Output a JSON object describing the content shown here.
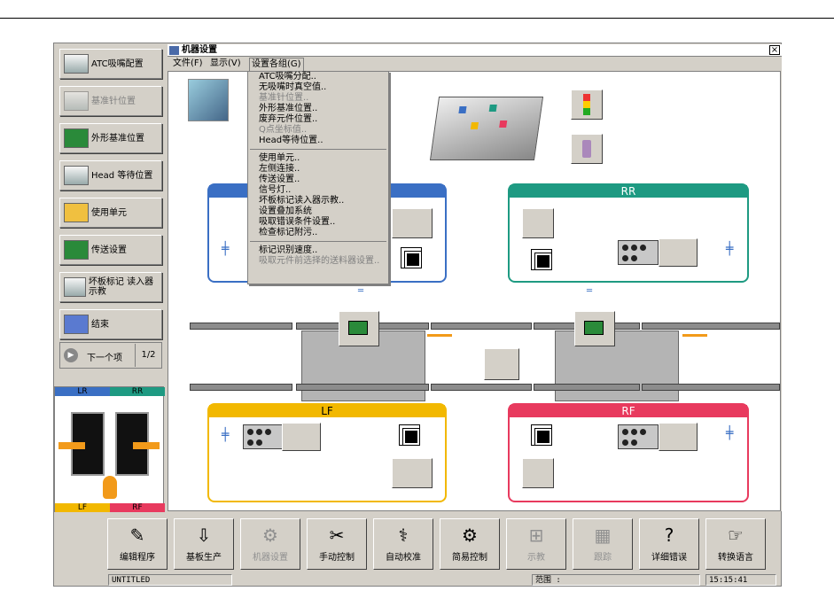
{
  "left_panel": {
    "buttons": [
      {
        "label": "ATC吸嘴配置"
      },
      {
        "label": "基准针位置"
      },
      {
        "label": "外形基准位置"
      },
      {
        "label": "Head 等待位置"
      },
      {
        "label": "使用单元"
      },
      {
        "label": "传送设置"
      },
      {
        "label": "坏板标记 读入器示教"
      },
      {
        "label": "结束"
      }
    ],
    "next_label": "下一个项",
    "page": "1/2",
    "heads": {
      "lr": "LR",
      "rr": "RR",
      "lf": "LF",
      "rf": "RF"
    }
  },
  "window": {
    "title": "机器设置",
    "close": "×",
    "menu": [
      "文件(F)",
      "显示(V)",
      "设置各组(G)"
    ],
    "dropdown": [
      {
        "label": "ATC吸嘴分配..",
        "disabled": false
      },
      {
        "label": "无吸嘴时真空值..",
        "disabled": false
      },
      {
        "label": "基准针位置..",
        "disabled": true
      },
      {
        "label": "外形基准位置..",
        "disabled": false
      },
      {
        "label": "废弃元件位置..",
        "disabled": false
      },
      {
        "label": "Q点坐标值..",
        "disabled": true
      },
      {
        "label": "Head等待位置..",
        "disabled": false
      },
      {
        "label": "---"
      },
      {
        "label": "使用单元..",
        "disabled": false
      },
      {
        "label": "左侧连接..",
        "disabled": false
      },
      {
        "label": "传送设置..",
        "disabled": false
      },
      {
        "label": "信号灯..",
        "disabled": false
      },
      {
        "label": "坏板标记读入器示教..",
        "disabled": false
      },
      {
        "label": "设置叠加系统",
        "disabled": false
      },
      {
        "label": "吸取错误条件设置..",
        "disabled": false
      },
      {
        "label": "检查标记附污..",
        "disabled": false
      },
      {
        "label": "---"
      },
      {
        "label": "标记识别速度..",
        "disabled": false
      },
      {
        "label": "吸取元件前选择的送料器设置..",
        "disabled": true
      }
    ],
    "heads": {
      "rr": "RR",
      "lf": "LF",
      "rf": "RF"
    }
  },
  "toolbar": [
    {
      "label": "编辑程序",
      "icon": "edit-program-icon",
      "disabled": false
    },
    {
      "label": "基板生产",
      "icon": "production-icon",
      "disabled": false
    },
    {
      "label": "机器设置",
      "icon": "machine-setup-icon",
      "disabled": true
    },
    {
      "label": "手动控制",
      "icon": "manual-control-icon",
      "disabled": false
    },
    {
      "label": "自动校准",
      "icon": "auto-calibrate-icon",
      "disabled": false
    },
    {
      "label": "简易控制",
      "icon": "simple-control-icon",
      "disabled": false
    },
    {
      "label": "示教",
      "icon": "teach-icon",
      "disabled": true
    },
    {
      "label": "跟踪",
      "icon": "trace-icon",
      "disabled": true
    },
    {
      "label": "详细错误",
      "icon": "error-detail-icon",
      "disabled": false
    },
    {
      "label": "转换语言",
      "icon": "language-icon",
      "disabled": false
    }
  ],
  "status": {
    "program": "UNTITLED",
    "range_label": "范围 :",
    "time": "15:15:41"
  },
  "colors": {
    "lr": "#3a6fc4",
    "rr": "#1e9a82",
    "lf": "#f2b800",
    "rf": "#e83a5e"
  }
}
